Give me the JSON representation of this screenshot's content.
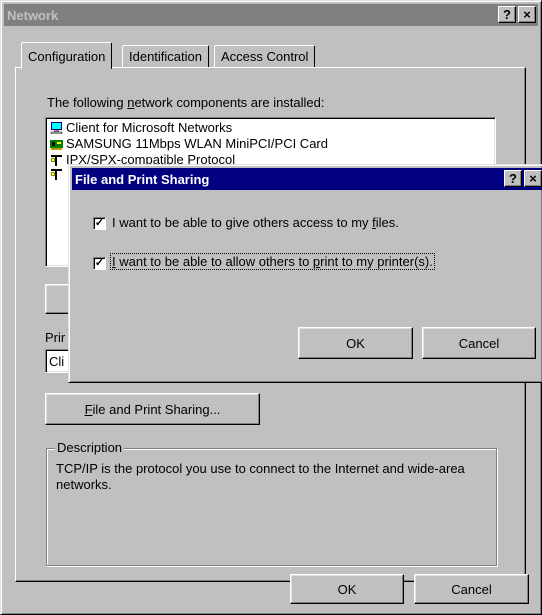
{
  "network": {
    "title": "Network",
    "help_glyph": "?",
    "close_glyph": "×",
    "tabs": [
      {
        "label": "Configuration"
      },
      {
        "label": "Identification"
      },
      {
        "label": "Access Control"
      }
    ],
    "components_label_pre": "The following ",
    "components_label_u": "n",
    "components_label_post": "etwork components are installed:",
    "components": [
      {
        "label": "Client for Microsoft Networks",
        "icon": "client-computer-icon"
      },
      {
        "label": "SAMSUNG 11Mbps WLAN MiniPCI/PCI Card",
        "icon": "network-adapter-icon"
      },
      {
        "label": "IPX/SPX-compatible Protocol",
        "icon": "protocol-icon"
      },
      {
        "label": "",
        "icon": "protocol-icon"
      }
    ],
    "primary_logon_label": "Prir",
    "primary_logon_value": "Cli",
    "file_print_button_u": "F",
    "file_print_button_rest": "ile and Print Sharing...",
    "description_title": "Description",
    "description_text": "TCP/IP is the protocol you use to connect to the Internet and wide-area networks.",
    "ok_label": "OK",
    "cancel_label": "Cancel"
  },
  "dialog": {
    "title": "File and Print Sharing",
    "help_glyph": "?",
    "close_glyph": "×",
    "option1_pre": "I want to be able to give others access to my ",
    "option1_u": "f",
    "option1_post": "iles.",
    "option1_checked": "✓",
    "option2_u": "I",
    "option2_mid": " want to be able to allow others to ",
    "option2_u2": "p",
    "option2_post": "rint to my printer(s).",
    "option2_checked": "✓",
    "ok_label": "OK",
    "cancel_label": "Cancel"
  },
  "colors": {
    "inactive_title": "#808080",
    "active_title": "#000080",
    "face": "#c0c0c0"
  }
}
